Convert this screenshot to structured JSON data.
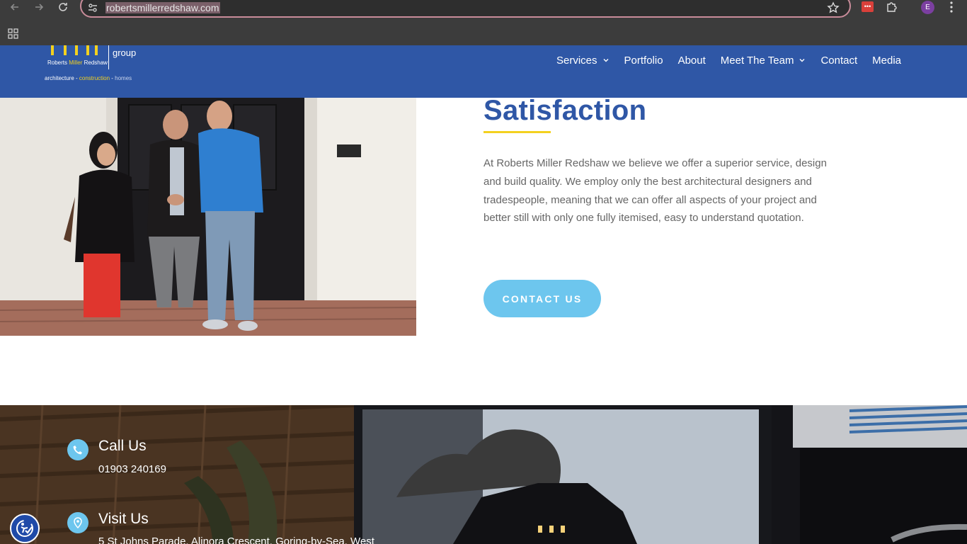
{
  "browser": {
    "url": "robertsmillerredshaw.com",
    "profile_initial": "E",
    "extension_badge": "•••"
  },
  "site": {
    "logo": {
      "group": "group",
      "name_left": "Roberts",
      "name_mid": "Miller",
      "name_right": "Redshaw",
      "tag_architecture": "architecture",
      "tag_sep1": " - ",
      "tag_construction": "construction",
      "tag_sep2": " - ",
      "tag_homes": "homes"
    },
    "nav": {
      "services": "Services",
      "portfolio": "Portfolio",
      "about": "About",
      "team": "Meet The Team",
      "contact": "Contact",
      "media": "Media"
    },
    "colors": {
      "header_blue": "#2f57a6",
      "accent_yellow": "#f3d11f",
      "button_cyan": "#6dc6ee"
    }
  },
  "hero": {
    "heading": "Satisfaction",
    "body": "At Roberts Miller Redshaw we believe we offer a superior service, design and build quality. We employ only the best architectural designers and tradespeople, meaning that we can offer all aspects of your project and better still with only one fully itemised, easy to understand quotation.",
    "button": "CONTACT US"
  },
  "footer": {
    "call_title": "Call Us",
    "call_number": "01903 240169",
    "visit_title": "Visit Us",
    "visit_address": "5 St Johns Parade, Alinora Crescent, Goring-by-Sea, West"
  }
}
